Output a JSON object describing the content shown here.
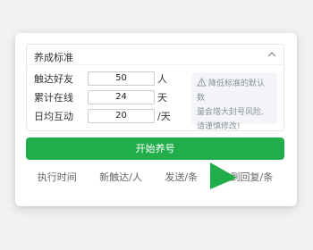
{
  "panel": {
    "title": "养成标准",
    "fields": [
      {
        "label": "触达好友",
        "value": "50",
        "unit": "人"
      },
      {
        "label": "累计在线",
        "value": "24",
        "unit": "天"
      },
      {
        "label": "日均互动",
        "value": "20",
        "unit": "/天"
      }
    ],
    "warning": {
      "icon": "warning-triangle-icon",
      "line1": "降低标准的默认数",
      "line2": "量会增大封号风险,",
      "line3": "请谨慎修改!"
    }
  },
  "start_button": {
    "label": "开始养号"
  },
  "stats": {
    "exec_time": "执行时间",
    "new_reach": "新触达/人",
    "sent": "发送/条",
    "received": "收到回复/条"
  },
  "colors": {
    "accent": "#22ad4b",
    "warning_bg": "#f4f5f9"
  }
}
